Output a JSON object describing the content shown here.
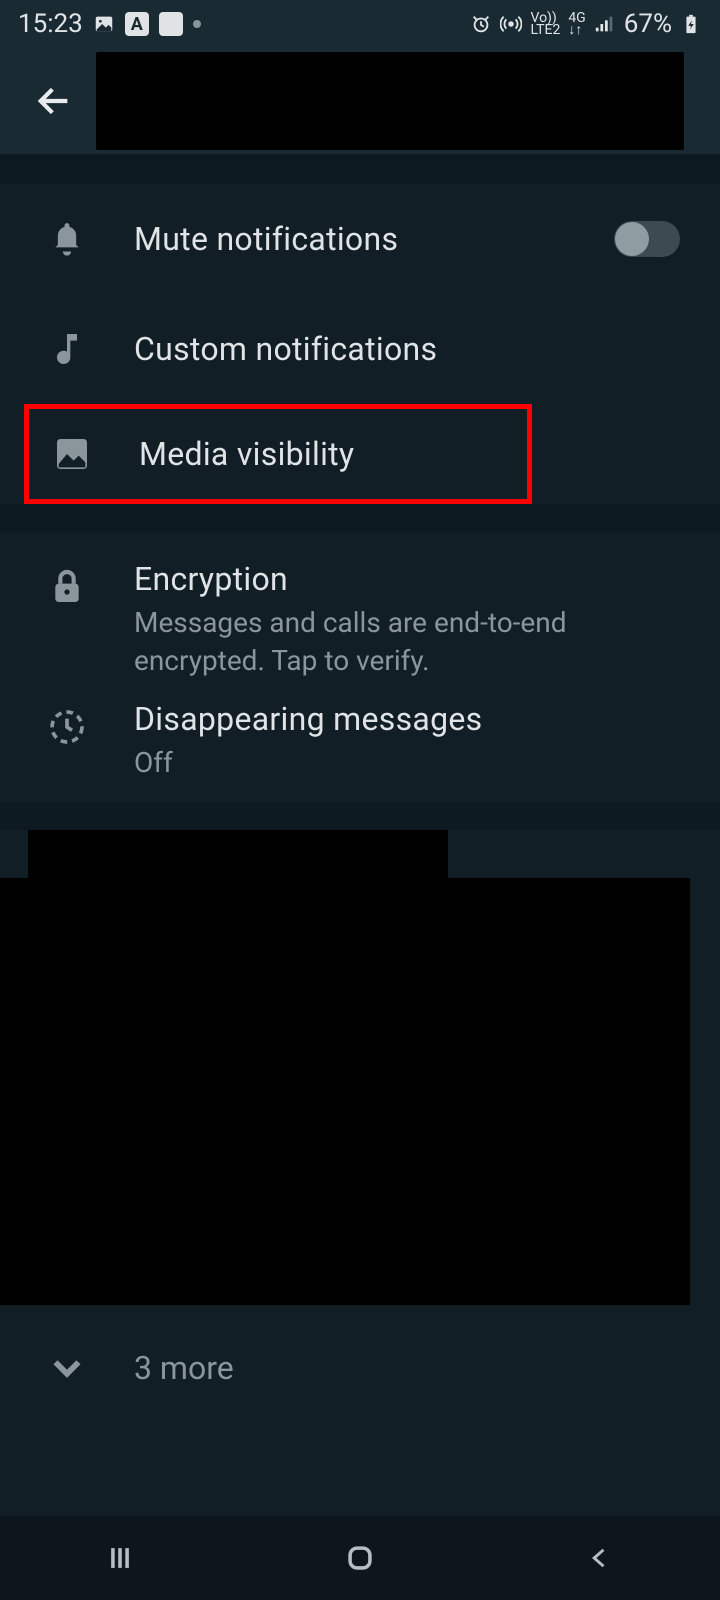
{
  "status": {
    "time": "15:23",
    "battery": "67%"
  },
  "settings": {
    "mute": {
      "label": "Mute notifications",
      "enabled": false
    },
    "custom": {
      "label": "Custom notifications"
    },
    "media": {
      "label": "Media visibility"
    },
    "encryption": {
      "label": "Encryption",
      "desc": "Messages and calls are end-to-end encrypted. Tap to verify."
    },
    "disappearing": {
      "label": "Disappearing messages",
      "value": "Off"
    }
  },
  "more": {
    "label": "3 more"
  }
}
